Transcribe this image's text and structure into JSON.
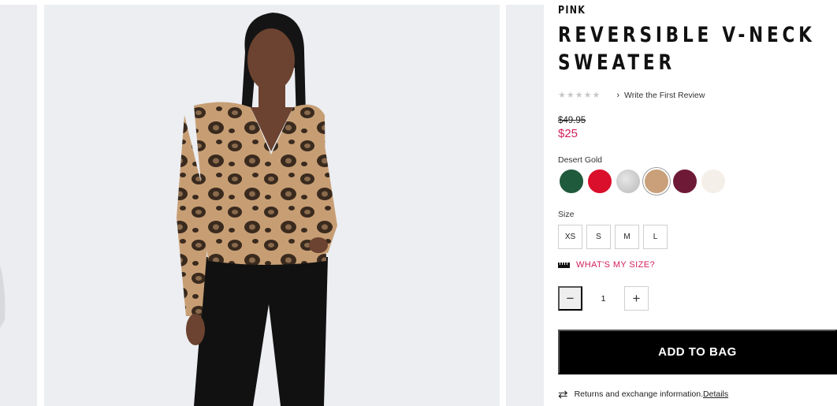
{
  "product": {
    "brand": "PINK",
    "title_line1": "REVERSIBLE V-NECK",
    "title_line2": "SWEATER",
    "rating_stars": "★★★★★",
    "review_link": "Write the First Review",
    "price_original": "$49.95",
    "price_sale": "$25",
    "selected_color": "Desert Gold",
    "colors": [
      {
        "name": "green",
        "hex": "#1f5a3c"
      },
      {
        "name": "red",
        "hex": "#d90f2b"
      },
      {
        "name": "heather-grey",
        "hex": "#c9c9c9"
      },
      {
        "name": "desert-gold",
        "hex": "#c9a07a",
        "selected": true
      },
      {
        "name": "burgundy",
        "hex": "#6e1a36"
      },
      {
        "name": "cream",
        "hex": "#f4efe8"
      }
    ],
    "size_label": "Size",
    "sizes": [
      "XS",
      "S",
      "M",
      "L"
    ],
    "size_guide": "WHAT'S MY SIZE?",
    "qty_minus": "−",
    "quantity": "1",
    "qty_plus": "+",
    "add_to_bag": "ADD TO BAG",
    "returns_text": "Returns and exchange information.",
    "returns_details": "Details"
  },
  "icons": {
    "ruler": "ruler-icon",
    "returns": "exchange-icon",
    "chevron": "chevron-right-icon"
  },
  "colors": {
    "accent_pink": "#d21f59",
    "button_black": "#000000"
  }
}
